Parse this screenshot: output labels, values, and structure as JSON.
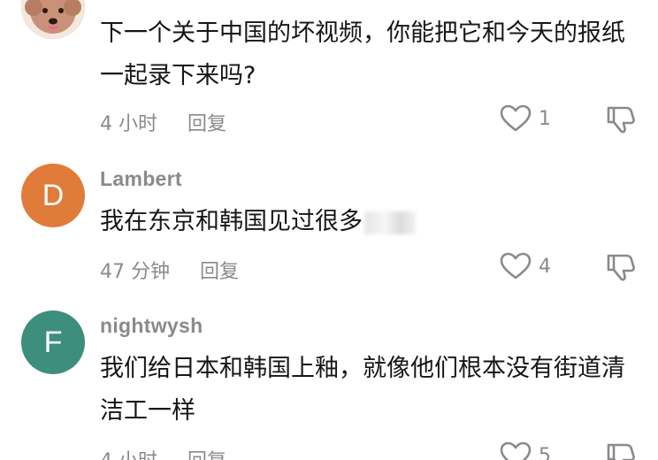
{
  "comments": [
    {
      "username": "",
      "avatar_letter": "",
      "avatar_kind": "photo",
      "text": "下一个关于中国的坏视频，你能把它和今天的报纸一起录下来吗?",
      "time": "4 小时",
      "reply": "回复",
      "likes": "1"
    },
    {
      "username": "Lambert",
      "avatar_letter": "D",
      "avatar_color": "#e07b39",
      "text": "我在东京和韩国见过很多",
      "time": "47 分钟",
      "reply": "回复",
      "likes": "4"
    },
    {
      "username": "nightwysh",
      "avatar_letter": "F",
      "avatar_color": "#3e8e7e",
      "text": "我们给日本和韩国上釉，就像他们根本没有街道清洁工一样",
      "time": "4 小时",
      "reply": "回复",
      "likes": "5"
    }
  ],
  "icons": {
    "like": "heart-outline-icon",
    "dislike": "thumbs-down-outline-icon"
  }
}
